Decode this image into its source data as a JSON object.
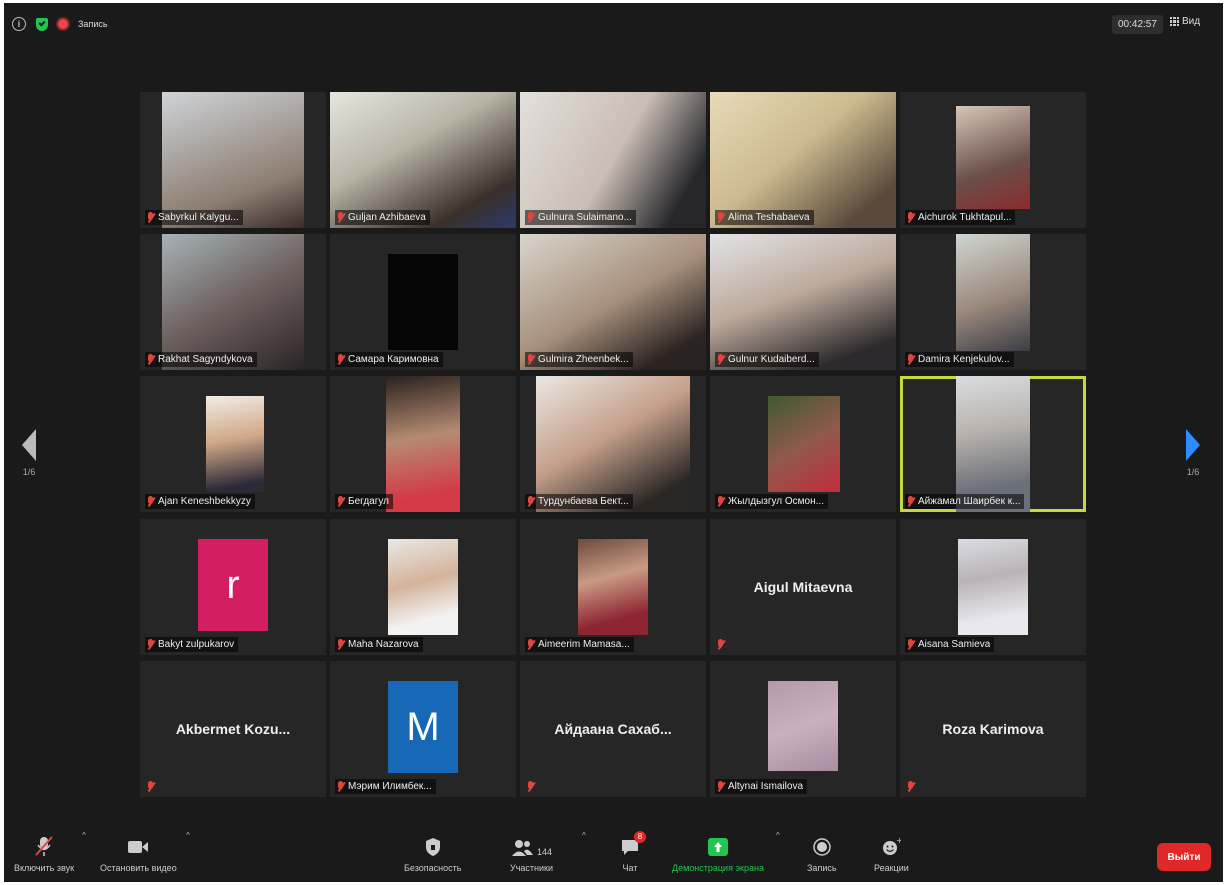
{
  "topbar": {
    "recording_label": "Запись",
    "timer": "00:42:57",
    "view_label": "Вид"
  },
  "pager": {
    "left_page": "1/6",
    "right_page": "1/6"
  },
  "participants": [
    {
      "name": "Sabyrkul Kalygu...",
      "kind": "video"
    },
    {
      "name": "Guljan Azhibaeva",
      "kind": "video"
    },
    {
      "name": "Gulnura Sulaimano...",
      "kind": "video"
    },
    {
      "name": "Alima Teshabaeva",
      "kind": "video"
    },
    {
      "name": "Aichurok Tukhtapul...",
      "kind": "video"
    },
    {
      "name": "Rakhat Sagyndykova",
      "kind": "video"
    },
    {
      "name": "Самара Каримовна",
      "kind": "video"
    },
    {
      "name": "Gulmira Zheenbek...",
      "kind": "video"
    },
    {
      "name": "Gulnur Kudaiberd...",
      "kind": "video"
    },
    {
      "name": "Damira Kenjekulov...",
      "kind": "video"
    },
    {
      "name": "Ajan Keneshbekkyzy",
      "kind": "video"
    },
    {
      "name": "Бегдагул",
      "kind": "video"
    },
    {
      "name": "Турдунбаева Бект...",
      "kind": "video"
    },
    {
      "name": "Жылдызгул Осмон...",
      "kind": "video"
    },
    {
      "name": "Айжамал Шаирбек к...",
      "kind": "video",
      "active": true
    },
    {
      "name": "Bakyt zulpukarov",
      "kind": "avatar",
      "letter": "r",
      "color": "#d31e63"
    },
    {
      "name": "Maha Nazarova",
      "kind": "video"
    },
    {
      "name": "Aimeerim Mamasa...",
      "kind": "video"
    },
    {
      "name": "",
      "kind": "name",
      "display": "Aigul Mitaevna"
    },
    {
      "name": "Aisana Samieva",
      "kind": "video"
    },
    {
      "name": "",
      "kind": "name",
      "display": "Akbermet  Kozu..."
    },
    {
      "name": "Мэрим Илимбек...",
      "kind": "avatar",
      "letter": "M",
      "color": "#1769b8"
    },
    {
      "name": "",
      "kind": "name",
      "display": "Айдаана  Сахаб..."
    },
    {
      "name": "Altynai Ismailova",
      "kind": "video"
    },
    {
      "name": "",
      "kind": "name",
      "display": "Roza Karimova"
    }
  ],
  "toolbar": {
    "unmute": "Включить звук",
    "stop_video": "Остановить видео",
    "security": "Безопасность",
    "participants": "Участники",
    "participants_count": "144",
    "chat": "Чат",
    "chat_badge": "8",
    "share_screen": "Демонстрация экрана",
    "record": "Запись",
    "reactions": "Реакции",
    "leave": "Выйти"
  },
  "colors": {
    "active_speaker": "#c7d73f",
    "share": "#23c552",
    "leave": "#e02828",
    "muted": "#e0463f"
  }
}
